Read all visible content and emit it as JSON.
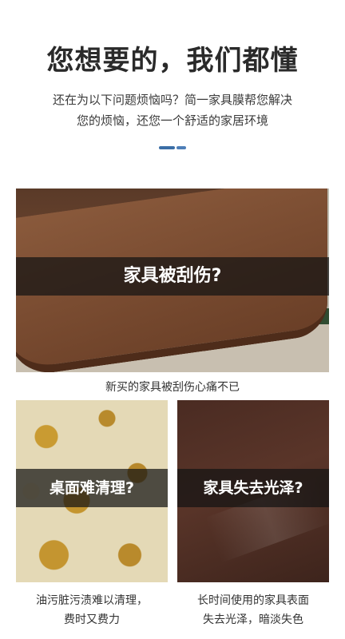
{
  "header": {
    "title": "您想要的，我们都懂",
    "subtitle_line1": "还在为以下问题烦恼吗？简一家具膜帮您解决",
    "subtitle_line2": "您的烦恼，还您一个舒适的家居环境",
    "divider_color": "#3b6ea6"
  },
  "panels": {
    "scratch": {
      "overlay_label": "家具被刮伤?",
      "caption": "新买的家具被刮伤心痛不已"
    },
    "stain": {
      "overlay_label": "桌面难清理?",
      "caption_line1": "油污脏污渍难以清理，",
      "caption_line2": "费时又费力"
    },
    "dull": {
      "overlay_label": "家具失去光泽?",
      "caption_line1": "长时间使用的家具表面",
      "caption_line2": "失去光泽，暗淡失色"
    }
  }
}
